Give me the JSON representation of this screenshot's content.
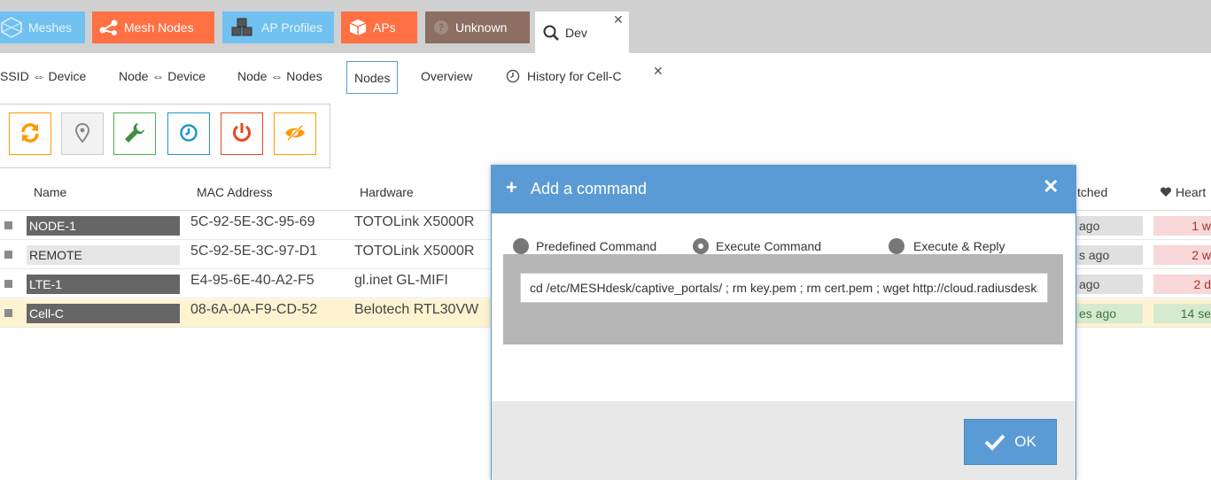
{
  "tabs": [
    {
      "label": "Meshes",
      "icon": "meshes-icon",
      "color": "#70c1f0"
    },
    {
      "label": "Mesh Nodes",
      "icon": "share-nodes-icon",
      "color": "#ff7043"
    },
    {
      "label": "AP Profiles",
      "icon": "cubes-icon",
      "color": "#70c1f0"
    },
    {
      "label": "APs",
      "icon": "cube-icon",
      "color": "#ff7043"
    },
    {
      "label": "Unknown",
      "icon": "question-icon",
      "color": "#8d6e63"
    },
    {
      "label": "Dev",
      "icon": "search-icon",
      "color": "#ffffff"
    }
  ],
  "subtabs": [
    {
      "label": "SSID ⇔ Device"
    },
    {
      "label": "Node ⇔ Device"
    },
    {
      "label": "Node ⇔ Nodes"
    },
    {
      "label": "Nodes"
    },
    {
      "label": "Overview"
    },
    {
      "label": "History for Cell-C"
    }
  ],
  "toolbar": {
    "buttons": [
      {
        "name": "reload-icon",
        "color": "#ff9800"
      },
      {
        "name": "map-marker-icon",
        "color": "#999999"
      },
      {
        "name": "wrench-icon",
        "color": "#4caf50"
      },
      {
        "name": "clock-icon",
        "color": "#2196c9"
      },
      {
        "name": "power-icon",
        "color": "#e64a19"
      },
      {
        "name": "eye-slash-icon",
        "color": "#ff9800"
      }
    ]
  },
  "grid": {
    "columns": {
      "name": "Name",
      "mac": "MAC Address",
      "hardware": "Hardware",
      "last_contact": "tched",
      "heartbeat": "Heart"
    },
    "rows": [
      {
        "name": "NODE-1",
        "mac": "5C-92-5E-3C-95-69",
        "hardware": "TOTOLink X5000R",
        "last_contact": "ago",
        "heartbeat": "1 w"
      },
      {
        "name": "REMOTE",
        "mac": "5C-92-5E-3C-97-D1",
        "hardware": "TOTOLink X5000R",
        "last_contact": "s ago",
        "heartbeat": "2 w"
      },
      {
        "name": "LTE-1",
        "mac": "E4-95-6E-40-A2-F5",
        "hardware": "gl.inet GL-MIFI",
        "last_contact": "ago",
        "heartbeat": "2 d"
      },
      {
        "name": "Cell-C",
        "mac": "08-6A-0A-F9-CD-52",
        "hardware": "Belotech RTL30VW",
        "last_contact": "es ago",
        "heartbeat": "14 se"
      }
    ]
  },
  "modal": {
    "title": "Add a command",
    "radios": [
      {
        "label": "Predefined Command",
        "selected": false
      },
      {
        "label": "Execute Command",
        "selected": true
      },
      {
        "label": "Execute & Reply",
        "selected": false
      }
    ],
    "command_value": "cd /etc/MESHdesk/captive_portals/ ; rm key.pem ; rm cert.pem ; wget http://cloud.radiusdesk.com",
    "ok_label": "OK"
  }
}
